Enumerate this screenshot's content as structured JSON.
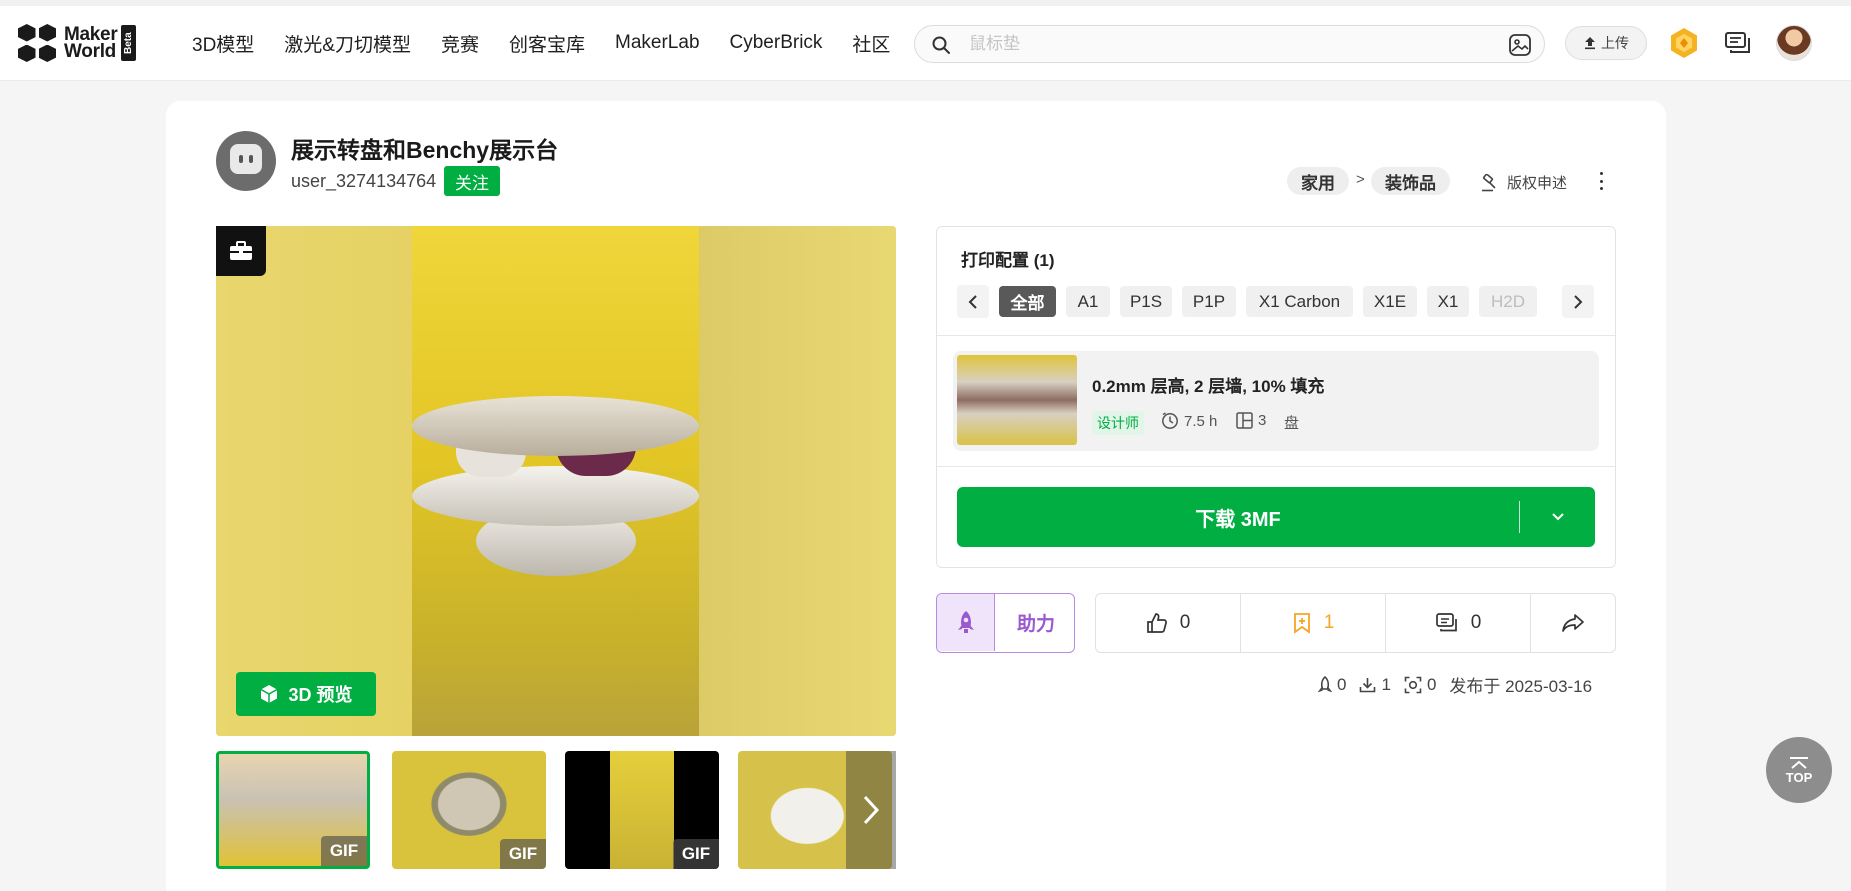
{
  "header": {
    "logo_line1": "Maker",
    "logo_line2": "World",
    "logo_beta": "Beta",
    "nav": [
      "3D模型",
      "激光&刀切模型",
      "竞赛",
      "创客宝库",
      "MakerLab",
      "CyberBrick",
      "社区"
    ],
    "search_placeholder": "鼠标垫",
    "upload_label": "上传"
  },
  "model": {
    "title": "展示转盘和Benchy展示台",
    "author": "user_3274134764",
    "follow_label": "关注",
    "category": [
      "家用",
      "装饰品"
    ],
    "category_separator": ">",
    "copyright_label": "版权申述",
    "preview_3d_label": "3D 预览",
    "thumbnails": [
      {
        "badge": "GIF",
        "selected": true
      },
      {
        "badge": "GIF",
        "selected": false
      },
      {
        "badge": "GIF",
        "selected": false
      },
      {
        "badge": "",
        "selected": false
      }
    ]
  },
  "print_config": {
    "title": "打印配置 (1)",
    "printers": [
      "全部",
      "A1",
      "P1S",
      "P1P",
      "X1 Carbon",
      "X1E",
      "X1",
      "H2D"
    ],
    "active_printer": "全部",
    "profile": {
      "name": "0.2mm 层高, 2 层墙, 10% 填充",
      "tag": "设计师",
      "time": "7.5 h",
      "plates": "3",
      "plate_label": "盘"
    },
    "download_label": "下载 3MF"
  },
  "actions": {
    "boost_label": "助力",
    "likes": "0",
    "favorites": "1",
    "comments": "0"
  },
  "stats": {
    "boosts": "0",
    "downloads": "1",
    "prints": "0",
    "published": "发布于 2025-03-16"
  },
  "top_button": "TOP",
  "colors": {
    "brand_green": "#00ae42",
    "boost_purple": "#9b59d0",
    "favorite_orange": "#f5a623"
  }
}
